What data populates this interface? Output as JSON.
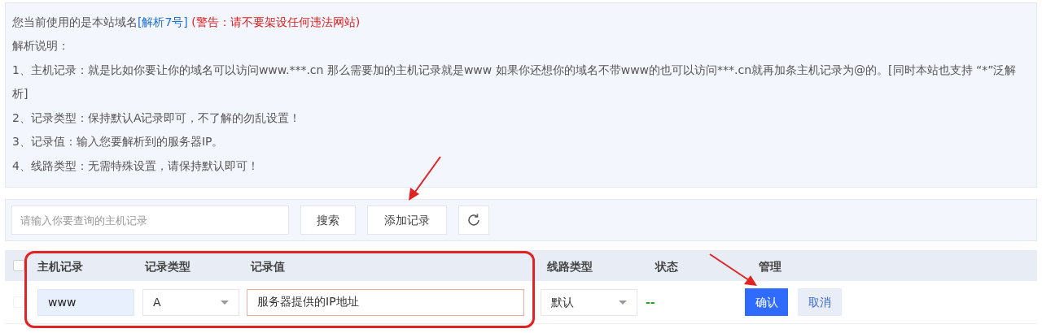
{
  "notice": {
    "first_line": [
      {
        "kind": "plain",
        "text": "您当前使用的是本站域名"
      },
      {
        "kind": "link",
        "text": "[解析7号]"
      },
      {
        "kind": "warning",
        "text": " (警告：请不要架设任何违法网站)"
      }
    ],
    "lines": [
      "解析说明：",
      "1、主机记录：就是比如你要让你的域名可以访问www.***.cn 那么需要加的主机记录就是www 如果你还想你的域名不带www的也可以访问***.cn就再加条主机记录为@的。[同时本站也支持 “*”泛解析]",
      "2、记录类型：保持默认A记录即可，不了解的勿乱设置！",
      "3、记录值：输入您要解析到的服务器IP。",
      "4、线路类型：无需特殊设置，请保持默认即可！"
    ]
  },
  "toolbar": {
    "search": {
      "placeholder": "请输入你要查询的主机记录"
    },
    "buttons": [
      "搜索",
      "添加记录"
    ]
  },
  "table": {
    "columns": [
      "主机记录",
      "记录类型",
      "记录值",
      "线路类型",
      "状态",
      "管理"
    ],
    "header_checked": false,
    "new_row": {
      "checked": false,
      "host": "www",
      "type": "A",
      "value": "服务器提供的IP地址",
      "line": "默认",
      "status": "--",
      "color": "#22a022",
      "actions": [
        {
          "kind": "primary",
          "label": "确认"
        },
        {
          "kind": "secondary",
          "label": "取消"
        }
      ]
    }
  }
}
